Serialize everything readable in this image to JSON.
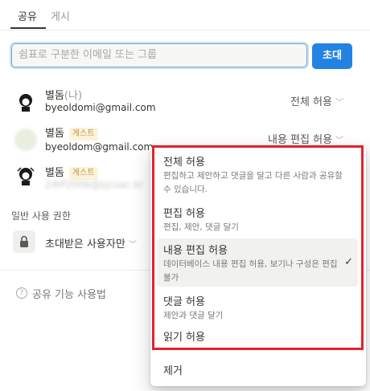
{
  "tabs": {
    "share": "공유",
    "publish": "게시"
  },
  "invite": {
    "placeholder": "쉼표로 구분한 이메일 또는 그룹",
    "button": "초대"
  },
  "members": [
    {
      "name": "별돔",
      "me_suffix": "(나)",
      "email": "byeoldomi@gmail.com",
      "role": "전체 허용"
    },
    {
      "name": "별돔",
      "badge": "게스트",
      "email": "byeoldom@gmail.com",
      "role": "내용 편집 허용"
    },
    {
      "name": "별돔",
      "badge": "게스트",
      "email": "24IP2006@sjcuac.kr"
    }
  ],
  "general_access": {
    "label": "일반 사용 권한",
    "value": "초대받은 사용자만"
  },
  "help": {
    "label": "공유 기능 사용법"
  },
  "dropdown": {
    "options": [
      {
        "title": "전체 허용",
        "description": "편집하고 제안하고 댓글을 달고 다른 사람과 공유할 수 있습니다."
      },
      {
        "title": "편집 허용",
        "description": "편집, 제안, 댓글 달기"
      },
      {
        "title": "내용 편집 허용",
        "description": "데이터베이스 내용 편집 허용, 보기나 구성은 편집 불가",
        "selected": true
      },
      {
        "title": "댓글 허용",
        "description": "제안과 댓글 달기"
      },
      {
        "title": "읽기 허용"
      }
    ],
    "remove": "제거",
    "highlight_color": "#e3232d"
  },
  "colors": {
    "accent": "#2383e2",
    "guest_badge_text": "#c29243",
    "guest_badge_bg": "#fbf3db"
  }
}
